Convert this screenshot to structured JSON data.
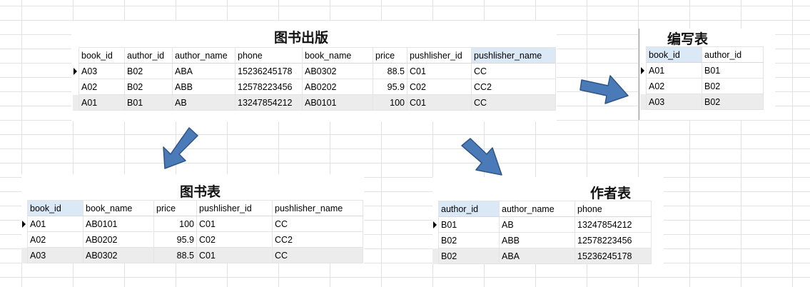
{
  "publishing": {
    "title": "图书出版",
    "columns": [
      "book_id",
      "author_id",
      "author_name",
      "phone",
      "book_name",
      "price",
      "pushlisher_id",
      "pushlisher_name"
    ],
    "rows": [
      [
        "A03",
        "B02",
        "ABA",
        "15236245178",
        "AB0302",
        "88.5",
        "C01",
        "CC"
      ],
      [
        "A02",
        "B02",
        "ABB",
        "12578223456",
        "AB0202",
        "95.9",
        "C02",
        "CC2"
      ],
      [
        "A01",
        "B01",
        "AB",
        "13247854212",
        "AB0101",
        "100",
        "C01",
        "CC"
      ]
    ]
  },
  "writing": {
    "title": "编写表",
    "columns": [
      "book_id",
      "author_id"
    ],
    "rows": [
      [
        "A01",
        "B01"
      ],
      [
        "A02",
        "B02"
      ],
      [
        "A03",
        "B02"
      ]
    ]
  },
  "books": {
    "title": "图书表",
    "columns": [
      "book_id",
      "book_name",
      "price",
      "pushlisher_id",
      "pushlisher_name"
    ],
    "rows": [
      [
        "A01",
        "AB0101",
        "100",
        "C01",
        "CC"
      ],
      [
        "A02",
        "AB0202",
        "95.9",
        "C02",
        "CC2"
      ],
      [
        "A03",
        "AB0302",
        "88.5",
        "C01",
        "CC"
      ]
    ]
  },
  "authors": {
    "title": "作者表",
    "columns": [
      "author_id",
      "author_name",
      "phone"
    ],
    "rows": [
      [
        "B01",
        "AB",
        "13247854212"
      ],
      [
        "B02",
        "ABB",
        "12578223456"
      ],
      [
        "B02",
        "ABA",
        "15236245178"
      ]
    ]
  },
  "colors": {
    "arrow_fill": "#4a7ab8",
    "arrow_stroke": "#2e5585",
    "header_highlight": "#dbe9f7",
    "row_shade": "#ececec"
  }
}
